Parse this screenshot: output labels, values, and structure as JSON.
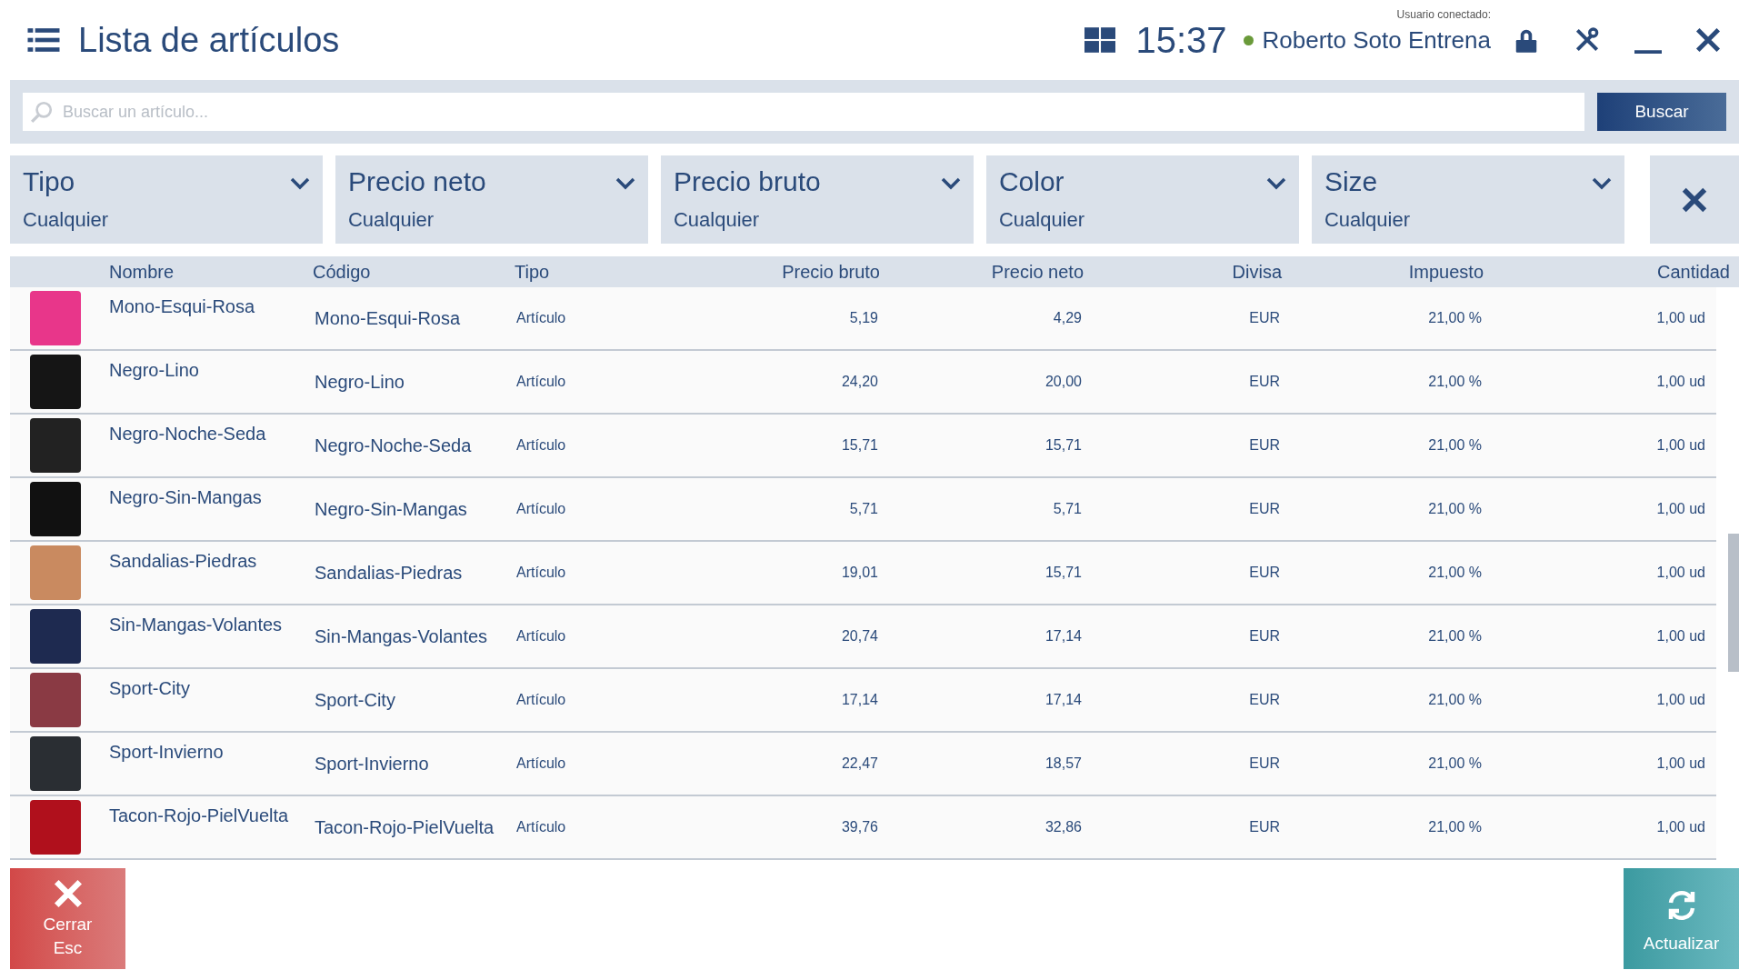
{
  "header": {
    "title": "Lista de artículos",
    "time": "15:37",
    "user_label": "Usuario conectado:",
    "user_name": "Roberto Soto Entrena",
    "online": true
  },
  "search": {
    "placeholder": "Buscar un artículo...",
    "button": "Buscar"
  },
  "filters": [
    {
      "label": "Tipo",
      "value": "Cualquier"
    },
    {
      "label": "Precio neto",
      "value": "Cualquier"
    },
    {
      "label": "Precio bruto",
      "value": "Cualquier"
    },
    {
      "label": "Color",
      "value": "Cualquier"
    },
    {
      "label": "Size",
      "value": "Cualquier"
    }
  ],
  "table": {
    "columns": [
      "Nombre",
      "Código",
      "Tipo",
      "Precio bruto",
      "Precio neto",
      "Divisa",
      "Impuesto",
      "Cantidad"
    ],
    "rows": [
      [
        "Mono-Esqui-Rosa",
        "Mono-Esqui-Rosa",
        "Artículo",
        "5,19",
        "4,29",
        "EUR",
        "21,00 %",
        "1,00 ud"
      ],
      [
        "Negro-Lino",
        "Negro-Lino",
        "Artículo",
        "24,20",
        "20,00",
        "EUR",
        "21,00 %",
        "1,00 ud"
      ],
      [
        "Negro-Noche-Seda",
        "Negro-Noche-Seda",
        "Artículo",
        "15,71",
        "15,71",
        "EUR",
        "21,00 %",
        "1,00 ud"
      ],
      [
        "Negro-Sin-Mangas",
        "Negro-Sin-Mangas",
        "Artículo",
        "5,71",
        "5,71",
        "EUR",
        "21,00 %",
        "1,00 ud"
      ],
      [
        "Sandalias-Piedras",
        "Sandalias-Piedras",
        "Artículo",
        "19,01",
        "15,71",
        "EUR",
        "21,00 %",
        "1,00 ud"
      ],
      [
        "Sin-Mangas-Volantes",
        "Sin-Mangas-Volantes",
        "Artículo",
        "20,74",
        "17,14",
        "EUR",
        "21,00 %",
        "1,00 ud"
      ],
      [
        "Sport-City",
        "Sport-City",
        "Artículo",
        "17,14",
        "17,14",
        "EUR",
        "21,00 %",
        "1,00 ud"
      ],
      [
        "Sport-Invierno",
        "Sport-Invierno",
        "Artículo",
        "22,47",
        "18,57",
        "EUR",
        "21,00 %",
        "1,00 ud"
      ],
      [
        "Tacon-Rojo-PielVuelta",
        "Tacon-Rojo-PielVuelta",
        "Artículo",
        "39,76",
        "32,86",
        "EUR",
        "21,00 %",
        "1,00 ud"
      ]
    ]
  },
  "actions": {
    "close": {
      "label": "Cerrar",
      "shortcut": "Esc"
    },
    "refresh": {
      "label": "Actualizar"
    }
  }
}
